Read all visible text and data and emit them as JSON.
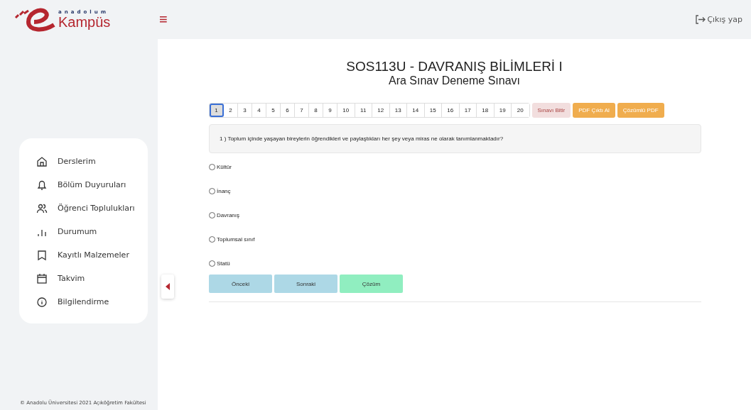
{
  "logo": {
    "top": "anadolum",
    "main": "Kampüs"
  },
  "menu_icon": "≡",
  "logout": {
    "label": "Çıkış yap"
  },
  "sidebar": {
    "items": [
      {
        "label": "Derslerim"
      },
      {
        "label": "Bölüm Duyuruları"
      },
      {
        "label": "Öğrenci Toplulukları"
      },
      {
        "label": "Durumum"
      },
      {
        "label": "Kayıtlı Malzemeler"
      },
      {
        "label": "Takvim"
      },
      {
        "label": "Bilgilendirme"
      }
    ],
    "footer": "© Anadolu Üniversitesi 2021 Açıköğretim Fakültesi"
  },
  "exam": {
    "title": "SOS113U - DAVRANIŞ BİLİMLERİ I",
    "subtitle": "Ara Sınav Deneme Sınavı",
    "pages": [
      {
        "label": "1",
        "selected": true
      },
      {
        "label": "2",
        "selected": false
      },
      {
        "label": "3",
        "selected": false
      },
      {
        "label": "4",
        "selected": false
      },
      {
        "label": "5",
        "selected": false
      },
      {
        "label": "6",
        "selected": false
      },
      {
        "label": "7",
        "selected": false
      },
      {
        "label": "8",
        "selected": false
      },
      {
        "label": "9",
        "selected": false
      },
      {
        "label": "10",
        "selected": false
      },
      {
        "label": "11",
        "selected": false
      },
      {
        "label": "12",
        "selected": false
      },
      {
        "label": "13",
        "selected": false
      },
      {
        "label": "14",
        "selected": false
      },
      {
        "label": "15",
        "selected": false
      },
      {
        "label": "16",
        "selected": false
      },
      {
        "label": "17",
        "selected": false
      },
      {
        "label": "18",
        "selected": false
      },
      {
        "label": "19",
        "selected": false
      },
      {
        "label": "20",
        "selected": false
      }
    ],
    "actions": [
      {
        "label": "Sınavı Bitir",
        "kind": "danger"
      },
      {
        "label": "PDF Çıktı Al",
        "kind": "warning"
      },
      {
        "label": "Çözümlü PDF",
        "kind": "warning"
      }
    ],
    "question": "1 ) Toplum içinde yaşayan bireylerin öğrendikleri ve paylaştıkları her şey veya miras ne olarak tanımlanmaktadır?",
    "options": [
      {
        "label": "Kültür",
        "selected": false
      },
      {
        "label": "İnanç",
        "selected": false
      },
      {
        "label": "Davranış",
        "selected": false
      },
      {
        "label": "Toplumsal sınıf",
        "selected": false
      },
      {
        "label": "Statü",
        "selected": false
      }
    ],
    "nav": [
      {
        "label": "Önceki",
        "kind": "info"
      },
      {
        "label": "Sonraki",
        "kind": "info"
      },
      {
        "label": "Çözüm",
        "kind": "success"
      }
    ]
  }
}
